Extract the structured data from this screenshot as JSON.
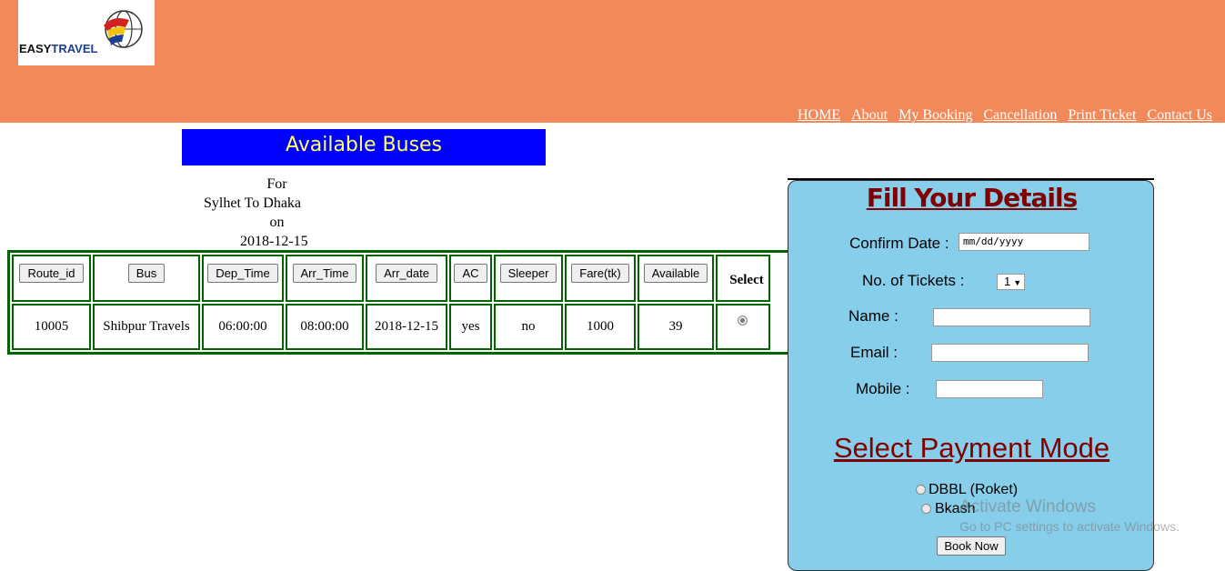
{
  "header": {
    "logo_main": "EASY",
    "logo_sub": "TRAVEL",
    "nav": [
      "HOME",
      "About",
      "My Booking",
      "Cancellation",
      "Print Ticket",
      "Contact Us"
    ]
  },
  "banner": {
    "title": "Available Buses"
  },
  "route": {
    "for": "For",
    "from_to": "Sylhet To Dhaka",
    "on": "on",
    "date": "2018-12-15"
  },
  "table": {
    "headers": [
      "Route_id",
      "Bus",
      "Dep_Time",
      "Arr_Time",
      "Arr_date",
      "AC",
      "Sleeper",
      "Fare(tk)",
      "Available"
    ],
    "select_header": "Select",
    "rows": [
      [
        "10005",
        "Shibpur Travels",
        "06:00:00",
        "08:00:00",
        "2018-12-15",
        "yes",
        "no",
        "1000",
        "39"
      ]
    ]
  },
  "form": {
    "title": "Fill Your Details",
    "confirm_date_label": "Confirm Date :",
    "confirm_date_placeholder": "mm/dd/yyyy",
    "tickets_label": "No. of Tickets :",
    "tickets_value": "1",
    "name_label": "Name :",
    "email_label": "Email :",
    "mobile_label": "Mobile :",
    "payment_title": "Select Payment Mode",
    "payment_options": [
      "DBBL (Roket)",
      "Bkash"
    ],
    "book_button": "Book Now"
  },
  "watermark": {
    "line1": "Activate Windows",
    "line2": "Go to PC settings to activate Windows."
  },
  "colors": {
    "header": "#f2895b",
    "banner": "#0000ff",
    "banner_text": "#ffff66",
    "panel": "#87ceeb",
    "form_title": "#800000",
    "table_border": "#006400"
  }
}
